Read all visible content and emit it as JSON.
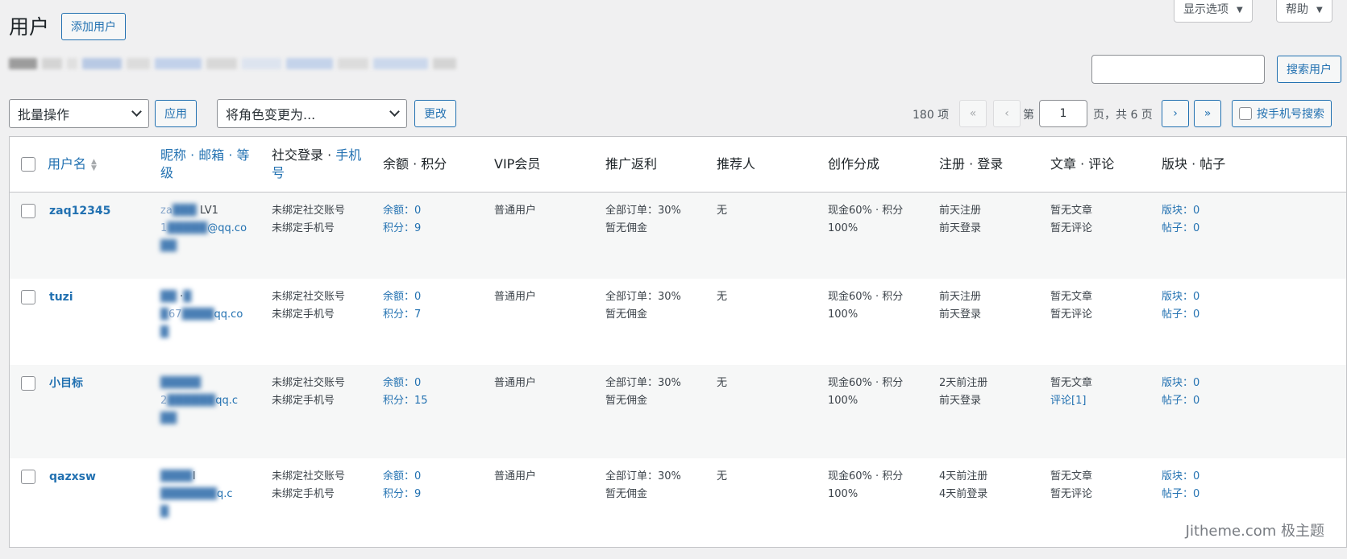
{
  "header": {
    "title": "用户",
    "add_user": "添加用户",
    "screen_options": "显示选项",
    "help": "帮助"
  },
  "search": {
    "button": "搜索用户",
    "value": ""
  },
  "tablenav": {
    "bulk_action": "批量操作",
    "apply": "应用",
    "change_role": "将角色变更为...",
    "change": "更改",
    "count": "180 项",
    "first": "«",
    "prev": "‹",
    "page_label": "第",
    "current_page": "1",
    "page_total": "页，共 6 页",
    "next": "›",
    "last": "»",
    "phone_search": "按手机号搜索"
  },
  "columns": {
    "username": "用户名",
    "nick_a": "昵称 · ",
    "nick_b": "邮箱 · 等级",
    "social_a": "社交登录 · ",
    "social_b": "手机号",
    "balance": "余额 · 积分",
    "vip": "VIP会员",
    "promo": "推广返利",
    "referrer": "推荐人",
    "creator": "创作分成",
    "reg": "注册 · 登录",
    "posts": "文章 · 评论",
    "forum": "版块 · 帖子"
  },
  "rows": [
    {
      "username": "zaq12345",
      "nick": "za",
      "level": "LV1",
      "email_a": "1",
      "email_b": "@qq.co",
      "social": "未绑定社交账号",
      "phone": "未绑定手机号",
      "balance": "余额：0",
      "points": "积分：9",
      "vip": "普通用户",
      "promo_orders": "全部订单：30%",
      "promo_comm": "暂无佣金",
      "referrer": "无",
      "creator_a": "现金60% · 积分",
      "creator_b": "100%",
      "reg": "前天注册",
      "login": "前天登录",
      "articles": "暂无文章",
      "comments": "暂无评论",
      "boards": "版块：0",
      "topics": "帖子：0"
    },
    {
      "username": "tuzi",
      "nick": "·",
      "level": "",
      "email_a": "67",
      "email_b": "qq.co",
      "social": "未绑定社交账号",
      "phone": "未绑定手机号",
      "balance": "余额：0",
      "points": "积分：7",
      "vip": "普通用户",
      "promo_orders": "全部订单：30%",
      "promo_comm": "暂无佣金",
      "referrer": "无",
      "creator_a": "现金60% · 积分",
      "creator_b": "100%",
      "reg": "前天注册",
      "login": "前天登录",
      "articles": "暂无文章",
      "comments": "暂无评论",
      "boards": "版块：0",
      "topics": "帖子：0"
    },
    {
      "username": "小目标",
      "nick": "",
      "level": "",
      "email_a": "2",
      "email_b": "qq.c",
      "social": "未绑定社交账号",
      "phone": "未绑定手机号",
      "balance": "余额：0",
      "points": "积分：15",
      "vip": "普通用户",
      "promo_orders": "全部订单：30%",
      "promo_comm": "暂无佣金",
      "referrer": "无",
      "creator_a": "现金60% · 积分",
      "creator_b": "100%",
      "reg": "2天前注册",
      "login": "前天登录",
      "articles": "暂无文章",
      "comments": "评论[1]",
      "boards": "版块：0",
      "topics": "帖子：0"
    },
    {
      "username": "qazxsw",
      "nick": "l",
      "level": "",
      "email_a": "",
      "email_b": "q.c",
      "social": "未绑定社交账号",
      "phone": "未绑定手机号",
      "balance": "余额：0",
      "points": "积分：9",
      "vip": "普通用户",
      "promo_orders": "全部订单：30%",
      "promo_comm": "暂无佣金",
      "referrer": "无",
      "creator_a": "现金60% · 积分",
      "creator_b": "100%",
      "reg": "4天前注册",
      "login": "4天前登录",
      "articles": "暂无文章",
      "comments": "暂无评论",
      "boards": "版块：0",
      "topics": "帖子：0"
    }
  ],
  "watermark": "Jitheme.com 极主题"
}
